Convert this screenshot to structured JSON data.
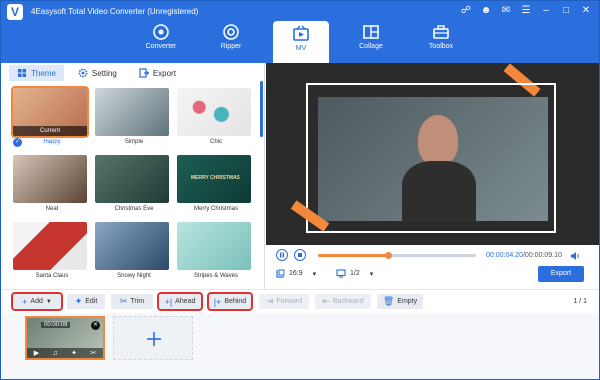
{
  "app": {
    "title": "4Easysoft Total Video Converter (Unregistered)",
    "logo": "V"
  },
  "window_controls": [
    "cart-icon",
    "user-icon",
    "feedback-icon",
    "menu-icon",
    "minimize-icon",
    "maximize-icon",
    "close-icon"
  ],
  "nav": {
    "items": [
      {
        "label": "Converter",
        "icon": "converter-icon"
      },
      {
        "label": "Ripper",
        "icon": "ripper-icon"
      },
      {
        "label": "MV",
        "icon": "mv-icon",
        "active": true
      },
      {
        "label": "Collage",
        "icon": "collage-icon"
      },
      {
        "label": "Toolbox",
        "icon": "toolbox-icon"
      }
    ]
  },
  "subtabs": [
    {
      "label": "Theme",
      "active": true
    },
    {
      "label": "Setting"
    },
    {
      "label": "Export"
    }
  ],
  "themes": [
    {
      "label": "Happy",
      "selected": true,
      "badge": "Current",
      "color": "#c98d6c"
    },
    {
      "label": "Simple",
      "color": "#6c7f86"
    },
    {
      "label": "Chic",
      "color": "#e7aab8"
    },
    {
      "label": "Neat",
      "color": "#70594b"
    },
    {
      "label": "Christmas Eve",
      "color": "#2e4f4a"
    },
    {
      "label": "Merry Christmas",
      "color": "#164c45"
    },
    {
      "label": "Santa Claus",
      "color": "#c43a32"
    },
    {
      "label": "Snowy Night",
      "color": "#3f5c7a"
    },
    {
      "label": "Stripes & Waves",
      "color": "#9fd5cf"
    }
  ],
  "overlay_texts": {
    "merry": "MERRY CHRISTMAS"
  },
  "player": {
    "progress": 0.44,
    "current_time": "00:00:04.20",
    "total_time": "/00:00:09.10",
    "ratio": "16:9",
    "screen": "1/2",
    "export_label": "Export"
  },
  "toolbar": {
    "add": "Add",
    "edit": "Edit",
    "trim": "Trim",
    "ahead": "Ahead",
    "behind": "Behind",
    "forward": "Forward",
    "backward": "Backward",
    "empty": "Empty",
    "page_current": "1",
    "page_total": "1"
  },
  "timeline": {
    "clip_time": "00:00:09"
  },
  "colors": {
    "accent": "#2a6fdd",
    "highlight": "#f3883c",
    "alert": "#e03131"
  }
}
